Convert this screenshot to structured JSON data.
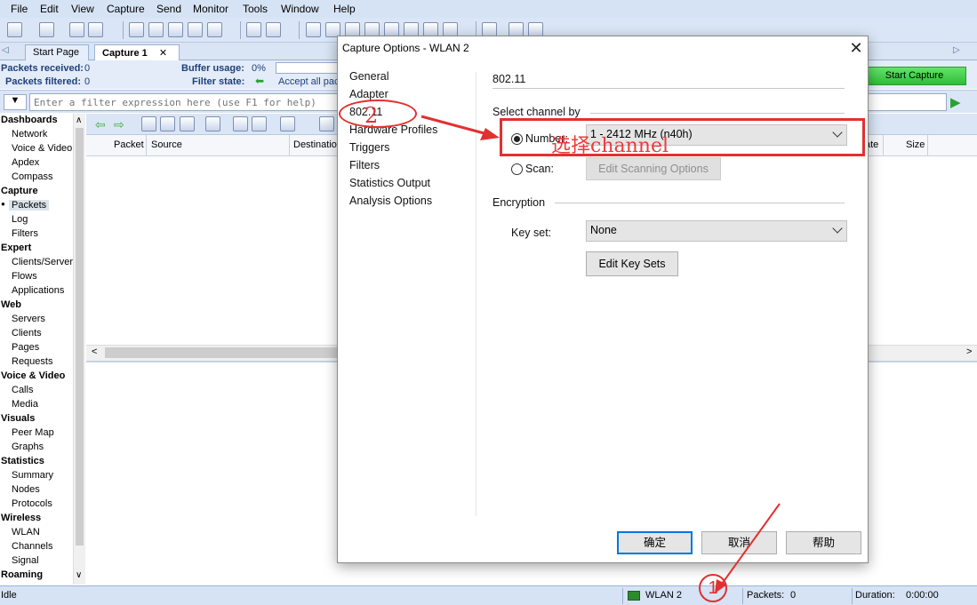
{
  "menu": [
    "File",
    "Edit",
    "View",
    "Capture",
    "Send",
    "Monitor",
    "Tools",
    "Window",
    "Help"
  ],
  "tabs": {
    "start_page": "Start Page",
    "capture1": "Capture 1",
    "close_glyph": "✕"
  },
  "info": {
    "packets_received_label": "Packets received:",
    "packets_received_value": "0",
    "packets_filtered_label": "Packets filtered:",
    "packets_filtered_value": "0",
    "buffer_usage_label": "Buffer usage:",
    "buffer_usage_value": "0%",
    "filter_state_label": "Filter state:",
    "filter_state_value": "Accept all pac"
  },
  "start_capture": "Start Capture",
  "filter": {
    "placeholder": "Enter a filter expression here (use F1 for help)"
  },
  "sidebar": {
    "dashboards": "Dashboards",
    "network": "Network",
    "voice_video": "Voice & Video",
    "apdex": "Apdex",
    "compass": "Compass",
    "capture": "Capture",
    "packets": "Packets",
    "log": "Log",
    "filters": "Filters",
    "expert": "Expert",
    "clients_servers": "Clients/Server",
    "flows": "Flows",
    "applications": "Applications",
    "web": "Web",
    "servers": "Servers",
    "clients": "Clients",
    "pages": "Pages",
    "requests": "Requests",
    "voice_video2": "Voice & Video",
    "calls": "Calls",
    "media": "Media",
    "visuals": "Visuals",
    "peer_map": "Peer Map",
    "graphs": "Graphs",
    "statistics": "Statistics",
    "summary": "Summary",
    "nodes": "Nodes",
    "protocols": "Protocols",
    "wireless": "Wireless",
    "wlan": "WLAN",
    "channels": "Channels",
    "signal": "Signal",
    "roaming": "Roaming",
    "scroll_up": "∧",
    "scroll_down": "∨",
    "bullet": "●"
  },
  "columns": {
    "packet": "Packet",
    "source": "Source",
    "destination": "Destinatio",
    "rate": "ate",
    "size": "Size"
  },
  "statusbar": {
    "idle": "Idle",
    "adapter": "WLAN 2",
    "packets_label": "Packets:",
    "packets_value": "0",
    "duration_label": "Duration:",
    "duration_value": "0:00:00"
  },
  "dialog": {
    "title": "Capture Options - WLAN 2",
    "close": "✕",
    "nav": [
      "General",
      "Adapter",
      "802.11",
      "Hardware Profiles",
      "Triggers",
      "Filters",
      "Statistics Output",
      "Analysis Options"
    ],
    "section_title": "802.11",
    "select_channel_by": "Select channel by",
    "number_label": "Number:",
    "number_value": "1 - 2412 MHz (n40h)",
    "scan_label": "Scan:",
    "edit_scanning": "Edit Scanning Options",
    "encryption": "Encryption",
    "keyset_label": "Key set:",
    "keyset_value": "None",
    "edit_key_sets": "Edit Key Sets",
    "ok": "确定",
    "cancel": "取消",
    "help": "帮助"
  },
  "annotations": {
    "label": "选择channel",
    "num1": "1",
    "num2": "2",
    "color": "#e23030"
  }
}
